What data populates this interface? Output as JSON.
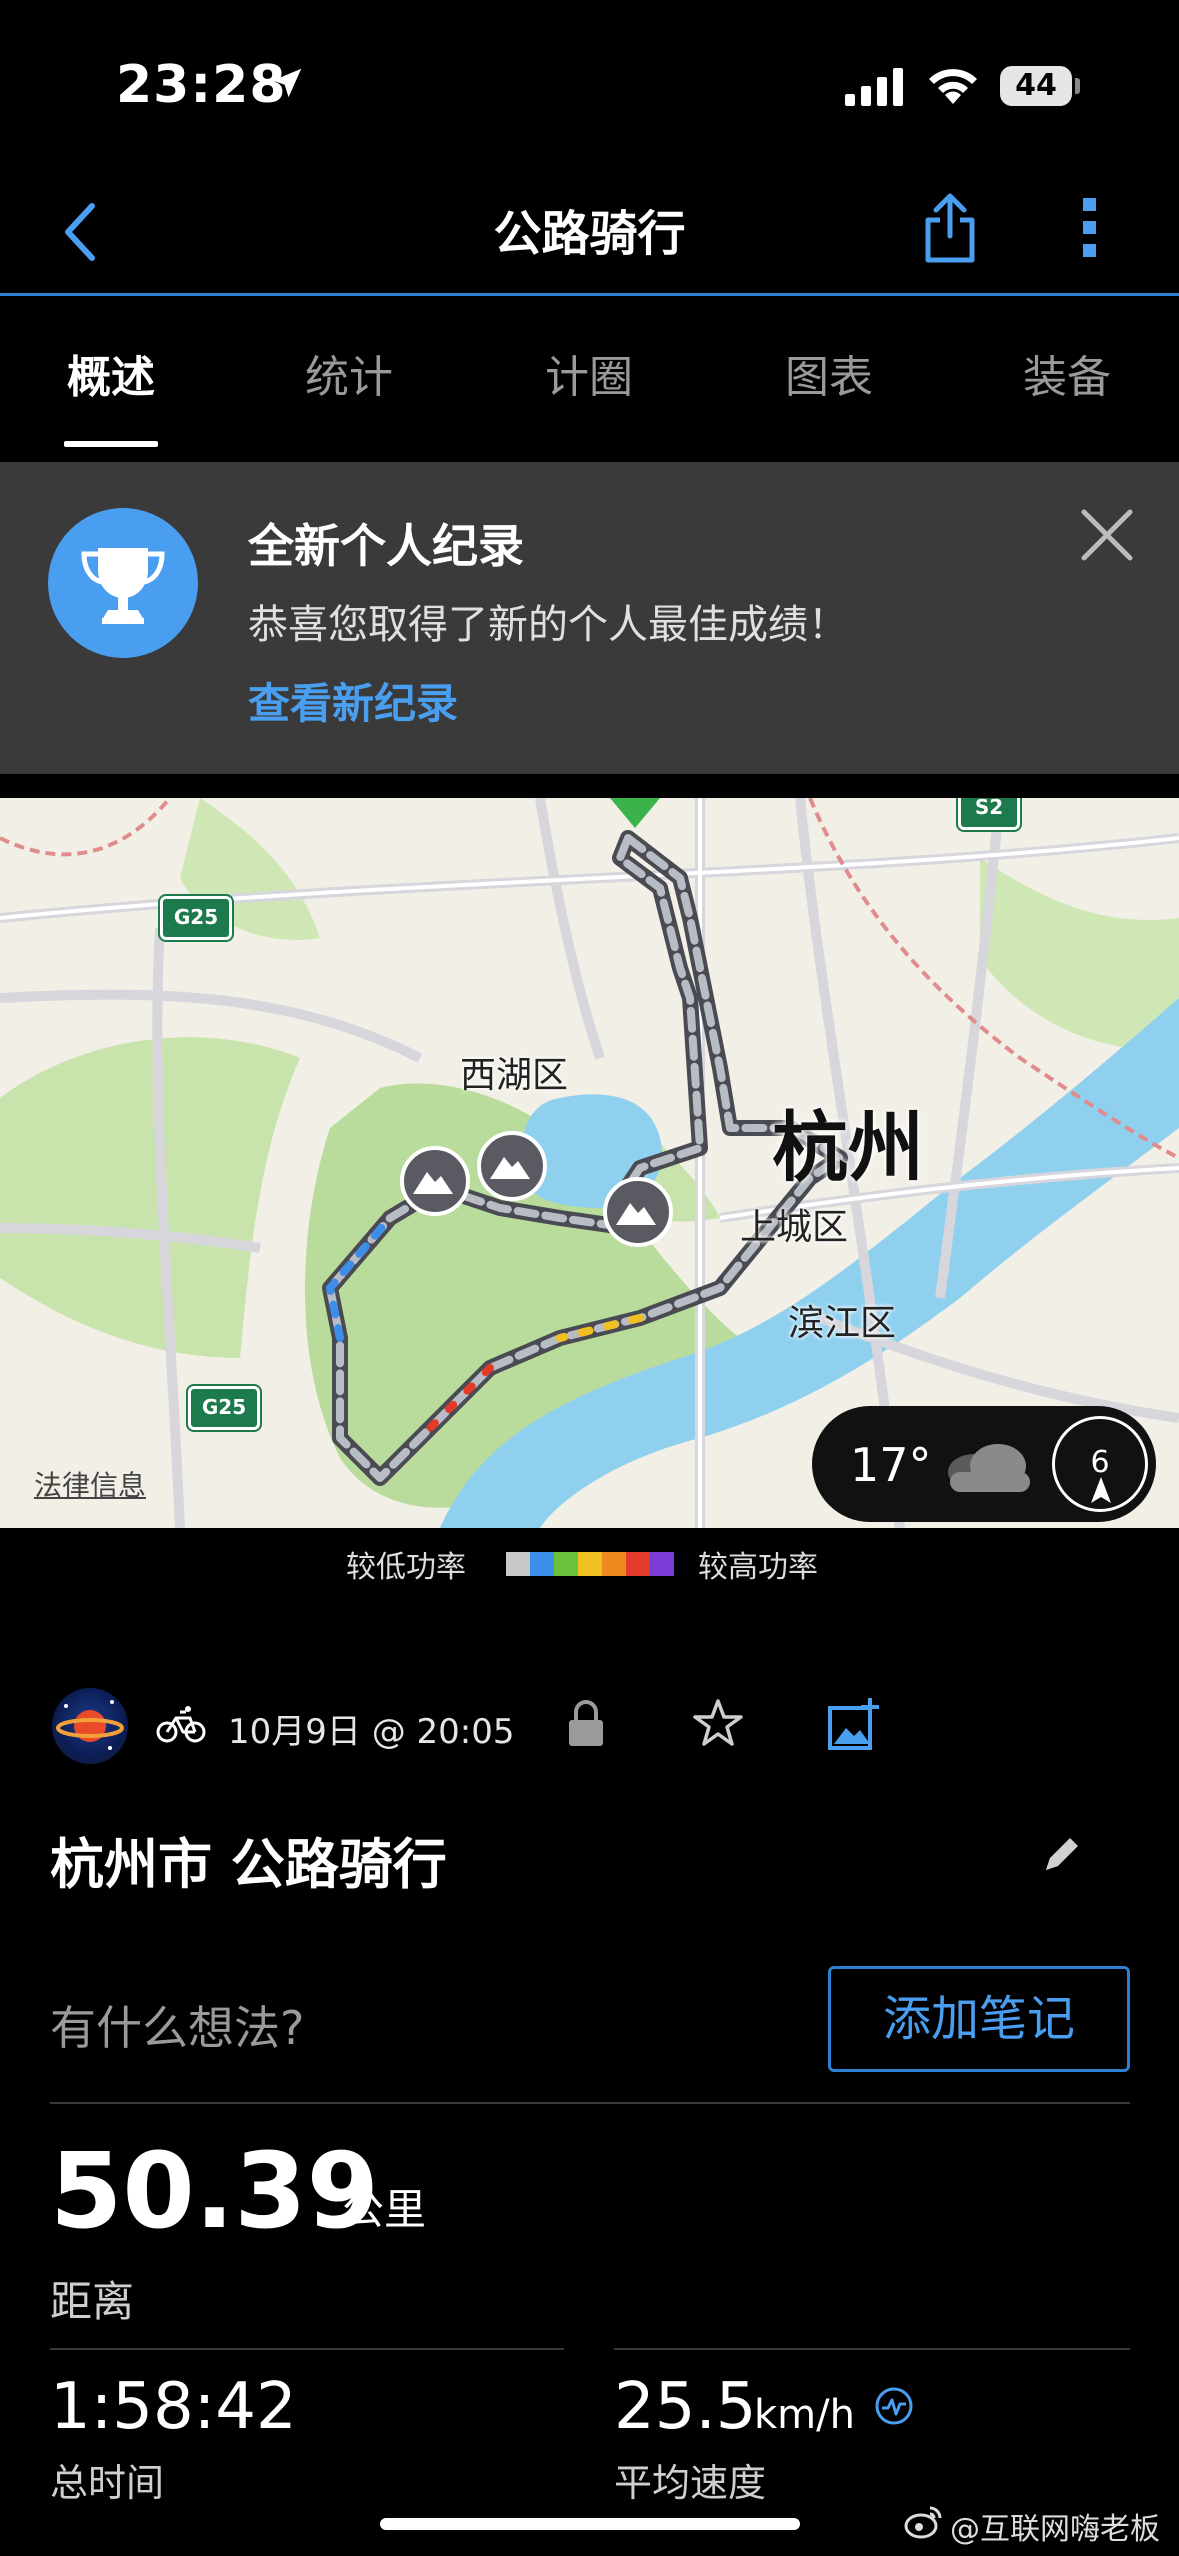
{
  "status_bar": {
    "time": "23:28",
    "battery": "44"
  },
  "nav": {
    "title": "公路骑行"
  },
  "tabs": [
    {
      "label": "概述",
      "active": true
    },
    {
      "label": "统计",
      "active": false
    },
    {
      "label": "计圈",
      "active": false
    },
    {
      "label": "图表",
      "active": false
    },
    {
      "label": "装备",
      "active": false
    }
  ],
  "banner": {
    "title": "全新个人纪录",
    "subtitle": "恭喜您取得了新的个人最佳成绩！",
    "link": "查看新纪录"
  },
  "map": {
    "labels": {
      "district_xihu": "西湖区",
      "city": "杭州",
      "district_shangcheng": "上城区",
      "district_binjiang": "滨江区"
    },
    "road_shields": {
      "g25_top": "G25",
      "g25_bottom": "G25",
      "s2": "S2"
    },
    "legal": "法律信息",
    "weather": {
      "temp": "17°",
      "wind": "6",
      "condition": "cloudy-icon"
    }
  },
  "legend": {
    "low": "较低功率",
    "high": "较高功率",
    "colors": [
      "#c8c8c8",
      "#3d8ee8",
      "#6ac23a",
      "#f0c020",
      "#f08a20",
      "#e23b2a",
      "#7a3bd6"
    ]
  },
  "activity": {
    "date": "10月9日 @ 20:05",
    "title": "杭州市 公路骑行",
    "note_prompt": "有什么想法?",
    "add_note": "添加笔记",
    "distance": {
      "value": "50.39",
      "unit": "公里",
      "label": "距离"
    },
    "total_time": {
      "value": "1:58:42",
      "label": "总时间"
    },
    "avg_speed": {
      "value": "25.5",
      "unit": "km/h",
      "label": "平均速度"
    }
  },
  "watermark": "@互联网嗨老板",
  "colors": {
    "accent": "#4a9ef0",
    "nav_border": "#2d7fd0",
    "banner_bg": "#3a3a3a"
  }
}
